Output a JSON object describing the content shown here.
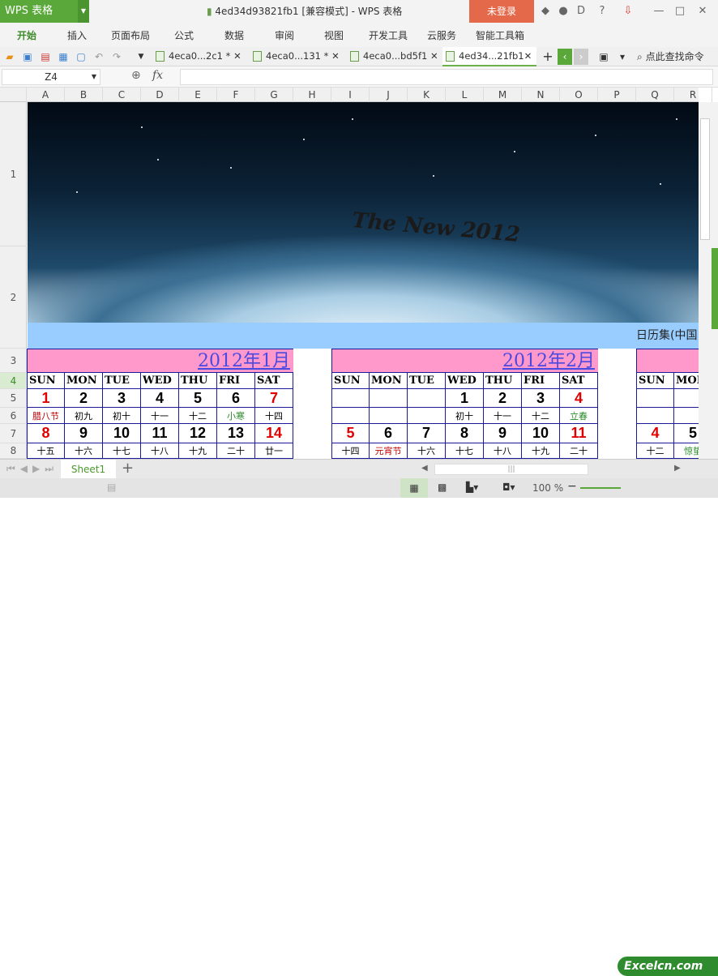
{
  "app": {
    "logo": "WPS 表格",
    "title": "4ed34d93821fb1 [兼容模式] - WPS 表格",
    "login": "未登录"
  },
  "menu": [
    "开始",
    "插入",
    "页面布局",
    "公式",
    "数据",
    "审阅",
    "视图",
    "开发工具",
    "云服务",
    "智能工具箱"
  ],
  "doc_tabs": [
    {
      "label": "4eca0...2c1 *"
    },
    {
      "label": "4eca0...131 *"
    },
    {
      "label": "4eca0...bd5f1"
    },
    {
      "label": "4ed34...21fb1",
      "active": true
    }
  ],
  "search_command": "点此查找命令",
  "formula": {
    "cell_ref": "Z4",
    "fx": "fx",
    "value": ""
  },
  "columns": [
    "A",
    "B",
    "C",
    "D",
    "E",
    "F",
    "G",
    "H",
    "I",
    "J",
    "K",
    "L",
    "M",
    "N",
    "O",
    "P",
    "Q",
    "R"
  ],
  "rows": [
    "1",
    "2",
    "3",
    "4",
    "5",
    "6",
    "7",
    "8"
  ],
  "banner": {
    "slogan": "The New 2012",
    "band_text": "日历集(中国"
  },
  "weekdays": [
    "SUN",
    "MON",
    "TUE",
    "WED",
    "THU",
    "FRI",
    "SAT"
  ],
  "colors": {
    "red": "#e00000",
    "black": "#000000",
    "green": "#2a8a2a",
    "holiday": "#c00000"
  },
  "calendars": [
    {
      "title": "2012年1月",
      "weeks": [
        {
          "days": [
            "1",
            "2",
            "3",
            "4",
            "5",
            "6",
            "7"
          ],
          "day_colors": [
            "red",
            "black",
            "black",
            "black",
            "black",
            "black",
            "red"
          ],
          "lunar": [
            "腊八节",
            "初九",
            "初十",
            "十一",
            "十二",
            "小寒",
            "十四"
          ],
          "lunar_colors": [
            "holiday",
            "black",
            "black",
            "black",
            "black",
            "green",
            "black"
          ]
        },
        {
          "days": [
            "8",
            "9",
            "10",
            "11",
            "12",
            "13",
            "14"
          ],
          "day_colors": [
            "red",
            "black",
            "black",
            "black",
            "black",
            "black",
            "red"
          ],
          "lunar": [
            "十五",
            "十六",
            "十七",
            "十八",
            "十九",
            "二十",
            "廿一"
          ],
          "lunar_colors": [
            "black",
            "black",
            "black",
            "black",
            "black",
            "black",
            "black"
          ]
        }
      ]
    },
    {
      "title": "2012年2月",
      "weeks": [
        {
          "days": [
            "",
            "",
            "",
            "1",
            "2",
            "3",
            "4"
          ],
          "day_colors": [
            "black",
            "black",
            "black",
            "black",
            "black",
            "black",
            "red"
          ],
          "lunar": [
            "",
            "",
            "",
            "初十",
            "十一",
            "十二",
            "立春"
          ],
          "lunar_colors": [
            "black",
            "black",
            "black",
            "black",
            "black",
            "black",
            "green"
          ]
        },
        {
          "days": [
            "5",
            "6",
            "7",
            "8",
            "9",
            "10",
            "11"
          ],
          "day_colors": [
            "red",
            "black",
            "black",
            "black",
            "black",
            "black",
            "red"
          ],
          "lunar": [
            "十四",
            "元宵节",
            "十六",
            "十七",
            "十八",
            "十九",
            "二十"
          ],
          "lunar_colors": [
            "black",
            "holiday",
            "black",
            "black",
            "black",
            "black",
            "black"
          ]
        }
      ]
    },
    {
      "title": "",
      "weeks": [
        {
          "days": [
            "",
            ""
          ],
          "day_colors": [
            "black",
            "black"
          ],
          "lunar": [
            "",
            ""
          ],
          "lunar_colors": [
            "black",
            "black"
          ]
        },
        {
          "days": [
            "4",
            "5"
          ],
          "day_colors": [
            "red",
            "black"
          ],
          "lunar": [
            "十二",
            "惊蛰"
          ],
          "lunar_colors": [
            "black",
            "green"
          ]
        }
      ]
    }
  ],
  "sheets": [
    "Sheet1"
  ],
  "status": {
    "zoom": "100 %",
    "watermark": "Excelcn.com"
  }
}
